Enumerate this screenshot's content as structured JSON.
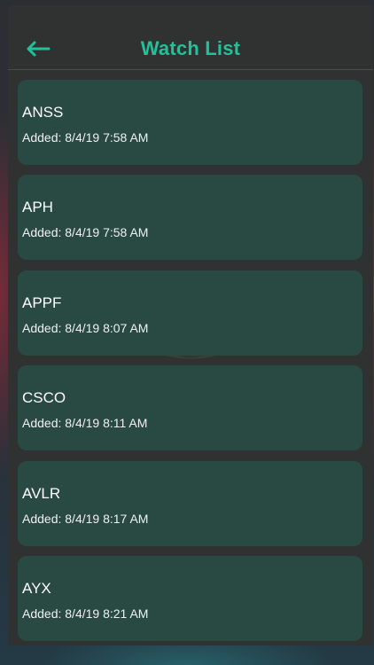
{
  "header": {
    "title": "Watch List",
    "back_icon": "arrow-left-icon",
    "accent_color": "#21c29a"
  },
  "watermark_icon": "eye-icon",
  "watchlist": [
    {
      "symbol": "ANSS",
      "added": "Added: 8/4/19 7:58 AM"
    },
    {
      "symbol": "APH",
      "added": "Added: 8/4/19 7:58 AM"
    },
    {
      "symbol": "APPF",
      "added": "Added: 8/4/19 8:07 AM"
    },
    {
      "symbol": "CSCO",
      "added": "Added: 8/4/19 8:11 AM"
    },
    {
      "symbol": "AVLR",
      "added": "Added: 8/4/19 8:17 AM"
    },
    {
      "symbol": "AYX",
      "added": "Added: 8/4/19 8:21 AM"
    }
  ]
}
